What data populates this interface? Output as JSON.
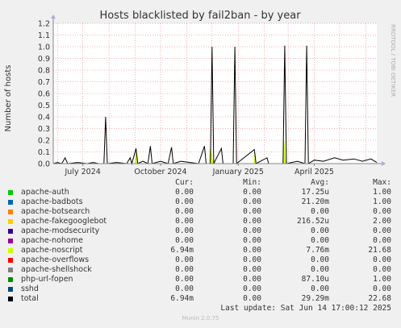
{
  "colors": {
    "grid": "#e26060",
    "axis": "#888888",
    "background": "#f0f0f0",
    "plot_background": "#ffffff",
    "total_line": "#000000"
  },
  "side_text": "RRDTOOL / TOBI OETIKER",
  "legend": {
    "headers": [
      "Cur:",
      "Min:",
      "Avg:",
      "Max:"
    ],
    "rows": [
      {
        "name": "apache-auth",
        "color": "#00cc00",
        "cur": "0.00",
        "min": "0.00",
        "avg": "17.25u",
        "max": "1.00"
      },
      {
        "name": "apache-badbots",
        "color": "#0066b3",
        "cur": "0.00",
        "min": "0.00",
        "avg": "21.20m",
        "max": "1.00"
      },
      {
        "name": "apache-botsearch",
        "color": "#ff8000",
        "cur": "0.00",
        "min": "0.00",
        "avg": "0.00",
        "max": "0.00"
      },
      {
        "name": "apache-fakegooglebot",
        "color": "#ffcc00",
        "cur": "0.00",
        "min": "0.00",
        "avg": "216.52u",
        "max": "2.00"
      },
      {
        "name": "apache-modsecurity",
        "color": "#330099",
        "cur": "0.00",
        "min": "0.00",
        "avg": "0.00",
        "max": "0.00"
      },
      {
        "name": "apache-nohome",
        "color": "#990099",
        "cur": "0.00",
        "min": "0.00",
        "avg": "0.00",
        "max": "0.00"
      },
      {
        "name": "apache-noscript",
        "color": "#ccff00",
        "cur": "6.94m",
        "min": "0.00",
        "avg": "7.76m",
        "max": "21.68"
      },
      {
        "name": "apache-overflows",
        "color": "#ff0000",
        "cur": "0.00",
        "min": "0.00",
        "avg": "0.00",
        "max": "0.00"
      },
      {
        "name": "apache-shellshock",
        "color": "#808080",
        "cur": "0.00",
        "min": "0.00",
        "avg": "0.00",
        "max": "0.00"
      },
      {
        "name": "php-url-fopen",
        "color": "#008f00",
        "cur": "0.00",
        "min": "0.00",
        "avg": "87.10u",
        "max": "1.00"
      },
      {
        "name": "sshd",
        "color": "#00487d",
        "cur": "0.00",
        "min": "0.00",
        "avg": "0.00",
        "max": "0.00"
      },
      {
        "name": "total",
        "color": "#000000",
        "cur": "6.94m",
        "min": "0.00",
        "avg": "29.29m",
        "max": "22.68"
      }
    ]
  },
  "last_update": "Last update: Sat Jun 14 17:00:12 2025",
  "footer": "Munin 2.0.75",
  "chart_data": {
    "type": "line",
    "title": "Hosts blacklisted by fail2ban - by year",
    "xlabel": "",
    "ylabel": "Number of hosts",
    "ylim": [
      0,
      1.2
    ],
    "xlim": [
      "2024-05-27",
      "2025-06-14"
    ],
    "y_ticks": [
      "0.0",
      "0.1",
      "0.2",
      "0.3",
      "0.4",
      "0.5",
      "0.6",
      "0.7",
      "0.8",
      "0.9",
      "1.0",
      "1.1",
      "1.2"
    ],
    "x_ticks": [
      {
        "label": "July 2024",
        "date": "2024-07-01"
      },
      {
        "label": "October 2024",
        "date": "2024-10-01"
      },
      {
        "label": "January 2025",
        "date": "2025-01-01"
      },
      {
        "label": "April 2025",
        "date": "2025-04-01"
      }
    ],
    "grid": true,
    "series": [
      {
        "name": "total",
        "color": "#000000",
        "points": [
          [
            "2024-05-27",
            0.0
          ],
          [
            "2024-06-01",
            0.01
          ],
          [
            "2024-06-06",
            0.0
          ],
          [
            "2024-06-10",
            0.05
          ],
          [
            "2024-06-13",
            0.0
          ],
          [
            "2024-06-25",
            0.01
          ],
          [
            "2024-07-06",
            0.0
          ],
          [
            "2024-07-13",
            0.01
          ],
          [
            "2024-07-20",
            0.0
          ],
          [
            "2024-07-26",
            0.0
          ],
          [
            "2024-07-28",
            0.4
          ],
          [
            "2024-07-30",
            0.0
          ],
          [
            "2024-08-10",
            0.01
          ],
          [
            "2024-08-22",
            0.0
          ],
          [
            "2024-08-26",
            0.05
          ],
          [
            "2024-08-28",
            0.0
          ],
          [
            "2024-09-02",
            0.13
          ],
          [
            "2024-09-04",
            0.0
          ],
          [
            "2024-09-10",
            0.02
          ],
          [
            "2024-09-16",
            0.0
          ],
          [
            "2024-09-19",
            0.15
          ],
          [
            "2024-09-21",
            0.0
          ],
          [
            "2024-10-01",
            0.02
          ],
          [
            "2024-10-10",
            0.0
          ],
          [
            "2024-10-14",
            0.14
          ],
          [
            "2024-10-16",
            0.0
          ],
          [
            "2024-10-25",
            0.02
          ],
          [
            "2024-11-05",
            0.01
          ],
          [
            "2024-11-15",
            0.0
          ],
          [
            "2024-11-22",
            0.15
          ],
          [
            "2024-11-24",
            0.0
          ],
          [
            "2024-11-29",
            0.0
          ],
          [
            "2024-12-01",
            1.0
          ],
          [
            "2024-12-03",
            0.0
          ],
          [
            "2024-12-12",
            0.13
          ],
          [
            "2024-12-14",
            0.0
          ],
          [
            "2024-12-26",
            0.0
          ],
          [
            "2024-12-28",
            1.0
          ],
          [
            "2024-12-30",
            0.0
          ],
          [
            "2025-01-20",
            0.12
          ],
          [
            "2025-01-22",
            0.0
          ],
          [
            "2025-02-04",
            0.05
          ],
          [
            "2025-02-06",
            0.0
          ],
          [
            "2025-02-23",
            0.0
          ],
          [
            "2025-02-25",
            1.01
          ],
          [
            "2025-02-27",
            0.0
          ],
          [
            "2025-03-12",
            0.02
          ],
          [
            "2025-03-21",
            0.0
          ],
          [
            "2025-03-23",
            1.01
          ],
          [
            "2025-03-25",
            0.0
          ],
          [
            "2025-04-01",
            0.03
          ],
          [
            "2025-04-12",
            0.02
          ],
          [
            "2025-04-25",
            0.05
          ],
          [
            "2025-05-05",
            0.03
          ],
          [
            "2025-05-18",
            0.04
          ],
          [
            "2025-05-28",
            0.02
          ],
          [
            "2025-06-07",
            0.04
          ],
          [
            "2025-06-14",
            0.01
          ]
        ]
      },
      {
        "name": "apache-noscript",
        "color": "#ccff00",
        "points": [
          [
            "2024-05-27",
            0.0
          ],
          [
            "2024-09-01",
            0.0
          ],
          [
            "2024-09-02",
            0.1
          ],
          [
            "2024-09-04",
            0.0
          ],
          [
            "2024-11-28",
            0.0
          ],
          [
            "2024-11-29",
            0.13
          ],
          [
            "2024-12-02",
            0.0
          ],
          [
            "2025-01-20",
            0.0
          ],
          [
            "2025-01-21",
            0.1
          ],
          [
            "2025-01-22",
            0.0
          ],
          [
            "2025-02-23",
            0.0
          ],
          [
            "2025-02-24",
            0.2
          ],
          [
            "2025-02-26",
            0.0
          ],
          [
            "2025-06-14",
            0.0
          ]
        ]
      }
    ]
  }
}
